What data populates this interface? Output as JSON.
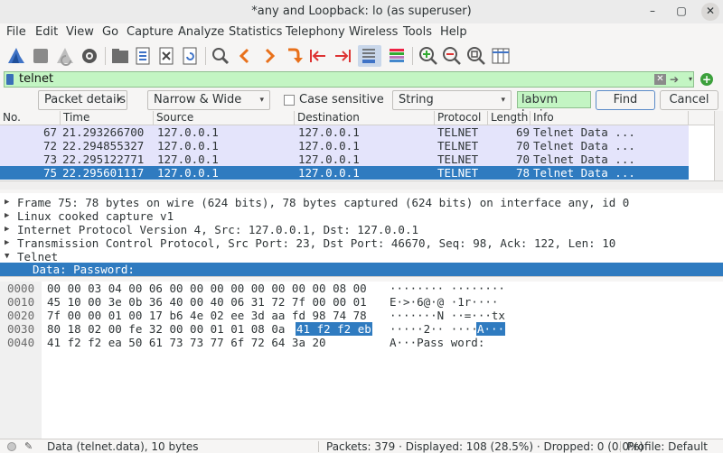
{
  "window": {
    "title": "*any and Loopback: lo (as superuser)",
    "min_glyph": "–",
    "max_glyph": "▢",
    "close_glyph": "✕"
  },
  "menu": [
    {
      "label": "File"
    },
    {
      "label": "Edit"
    },
    {
      "label": "View"
    },
    {
      "label": "Go"
    },
    {
      "label": "Capture"
    },
    {
      "label": "Analyze"
    },
    {
      "label": "Statistics"
    },
    {
      "label": "Telephony"
    },
    {
      "label": "Wireless"
    },
    {
      "label": "Tools"
    },
    {
      "label": "Help"
    }
  ],
  "toolbar_icons": [
    "start-capture-icon",
    "stop-capture-icon",
    "restart-capture-icon",
    "capture-options-icon",
    "open-file-icon",
    "save-file-icon",
    "close-file-icon",
    "reload-file-icon",
    "find-packet-icon",
    "go-back-icon",
    "go-forward-icon",
    "go-to-packet-icon",
    "first-packet-icon",
    "last-packet-icon",
    "auto-scroll-icon",
    "colorize-icon",
    "zoom-in-icon",
    "zoom-out-icon",
    "normal-size-icon",
    "resize-columns-icon"
  ],
  "filter": {
    "value": "telnet",
    "clear_glyph": "✕",
    "apply_glyph": "➔",
    "dropdown_glyph": "▾",
    "add_glyph": "+"
  },
  "findbar": {
    "search_in": "Packet details",
    "char_width": "Narrow & Wide",
    "case_sensitive_label": "Case sensitive",
    "search_type": "String",
    "search_value": "labvm login:",
    "find_label": "Find",
    "cancel_label": "Cancel",
    "arrow_glyph": "▾"
  },
  "packet_list": {
    "columns": [
      "No.",
      "Time",
      "Source",
      "Destination",
      "Protocol",
      "Length",
      "Info"
    ],
    "rows": [
      {
        "no": "67",
        "time": "21.293266700",
        "src": "127.0.0.1",
        "dst": "127.0.0.1",
        "proto": "TELNET",
        "len": "69",
        "info": "Telnet Data ..."
      },
      {
        "no": "72",
        "time": "22.294855327",
        "src": "127.0.0.1",
        "dst": "127.0.0.1",
        "proto": "TELNET",
        "len": "70",
        "info": "Telnet Data ..."
      },
      {
        "no": "73",
        "time": "22.295122771",
        "src": "127.0.0.1",
        "dst": "127.0.0.1",
        "proto": "TELNET",
        "len": "70",
        "info": "Telnet Data ..."
      },
      {
        "no": "75",
        "time": "22.295601117",
        "src": "127.0.0.1",
        "dst": "127.0.0.1",
        "proto": "TELNET",
        "len": "78",
        "info": "Telnet Data ..."
      }
    ]
  },
  "details": [
    {
      "arrow": "▶",
      "text": "Frame 75: 78 bytes on wire (624 bits), 78 bytes captured (624 bits) on interface any, id 0"
    },
    {
      "arrow": "▶",
      "text": "Linux cooked capture v1"
    },
    {
      "arrow": "▶",
      "text": "Internet Protocol Version 4, Src: 127.0.0.1, Dst: 127.0.0.1"
    },
    {
      "arrow": "▶",
      "text": "Transmission Control Protocol, Src Port: 23, Dst Port: 46670, Seq: 98, Ack: 122, Len: 10"
    },
    {
      "arrow": "▼",
      "text": "Telnet"
    },
    {
      "arrow": "",
      "text": "Data: Password:"
    }
  ],
  "bytes": [
    {
      "offset": "0000",
      "hex": "00 00 03 04 00 06 00 00  00 00 00 00 00 00 08 00",
      "hex_hl": "",
      "ascii": "········ ········",
      "ascii_hl": ""
    },
    {
      "offset": "0010",
      "hex": "45 10 00 3e 0b 36 40 00  40 06 31 72 7f 00 00 01",
      "hex_hl": "",
      "ascii": "E·>·6@·@ ·1r····",
      "ascii_hl": ""
    },
    {
      "offset": "0020",
      "hex": "7f 00 00 01 00 17 b6 4e  02 ee 3d aa fd 98 74 78",
      "hex_hl": "",
      "ascii": "·······N ··=···tx",
      "ascii_hl": ""
    },
    {
      "offset": "0030",
      "hex": "80 18 02 00 fe 32 00 00  01 01 08 0a",
      "hex_hl": "41 f2 f2 eb",
      "ascii": "·····2·· ····",
      "ascii_hl": "A···"
    },
    {
      "offset": "0040",
      "hex": "41 f2 f2 ea 50 61 73 73  77 6f 72 64 3a 20",
      "hex_hl": "",
      "ascii": "A···Pass word: ",
      "ascii_hl": ""
    }
  ],
  "status": {
    "field": "Data (telnet.data), 10 bytes",
    "packets": "Packets: 379 · Displayed: 108 (28.5%) · Dropped: 0 (0.0%)",
    "profile": "Profile: Default"
  }
}
